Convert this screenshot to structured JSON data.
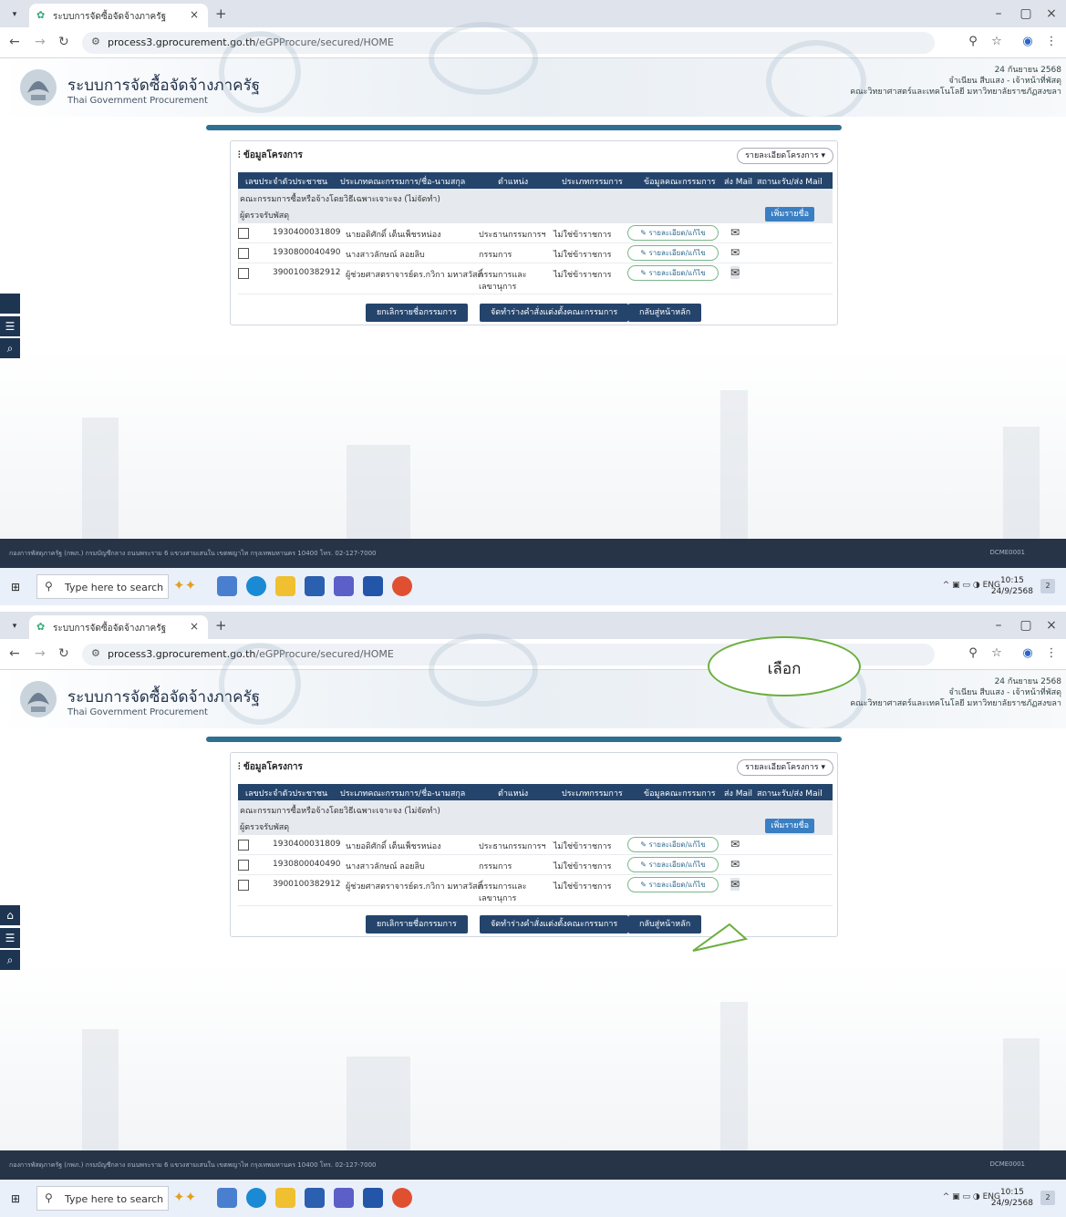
{
  "browser": {
    "tab_title": "ระบบการจัดซื้อจัดจ้างภาครัฐ",
    "url_host": "process3.gprocurement.go.th",
    "url_path": "/eGPProcure/secured/HOME"
  },
  "header": {
    "title": "ระบบการจัดซื้อจัดจ้างภาครัฐ",
    "subtitle": "Thai Government Procurement",
    "date": "24 กันยายน 2568",
    "user": "จำเนียน สีบแสง - เจ้าหน้าที่พัสดุ",
    "org": "คณะวิทยาศาสตร์และเทคโนโลยี มหาวิทยาลัยราชภัฏสงขลา"
  },
  "panel": {
    "title": "ข้อมูลโครงการ",
    "dropdown_label": "รายละเอียดโครงการ",
    "columns": [
      "เลขประจำตัวประชาชน",
      "ประเภทคณะกรรมการ/ชื่อ-นามสกุล",
      "ตำแหน่ง",
      "ประเภทกรรมการ",
      "ข้อมูลคณะกรรมการ",
      "ส่ง Mail",
      "สถานะรับ/ส่ง Mail"
    ],
    "group_committee": "คณะกรรมการซื้อหรือจ้างโดยวิธีเฉพาะเจาะจง (ไม่จัดทำ)",
    "group_inspector": "ผู้ตรวจรับพัสดุ",
    "add_button": "เพิ่มรายชื่อ",
    "edit_label": "รายละเอียด/แก้ไข",
    "rows": [
      {
        "id": "1930400031809",
        "name": "นายอดิศักดิ์ เต็นเพ็ชรหน่อง",
        "position": "ประธานกรรมการฯ",
        "type": "ไม่ใช่ข้าราชการ"
      },
      {
        "id": "1930800040490",
        "name": "นางสาวลักษณ์ ลอยลิบ",
        "position": "กรรมการ",
        "type": "ไม่ใช่ข้าราชการ"
      },
      {
        "id": "3900100382912",
        "name": "ผู้ช่วยศาสตราจารย์ดร.กวิกา มหาสวัสดิ์",
        "position": "กรรมการและ",
        "position2": "เลขานุการ",
        "type": "ไม่ใช่ข้าราชการ"
      }
    ],
    "btn_cancel": "ยกเลิกรายชื่อกรรมการ",
    "btn_draft": "จัดทำร่างคำสั่งแต่งตั้งคณะกรรมการ",
    "btn_back": "กลับสู่หน้าหลัก"
  },
  "footer": {
    "address": "กองการพัสดุภาครัฐ (กพภ.) กรมบัญชีกลาง ถนนพระราม 6 แขวงสามเสนใน เขตพญาไท กรุงเทพมหานคร 10400 โทร. 02-127-7000",
    "code": "DCME0001"
  },
  "taskbar": {
    "search_placeholder": "Type here to search",
    "lang": "ENG",
    "time": "10:15",
    "date": "24/9/2568",
    "notif_count": "2"
  },
  "callout": {
    "text": "เลือก"
  }
}
